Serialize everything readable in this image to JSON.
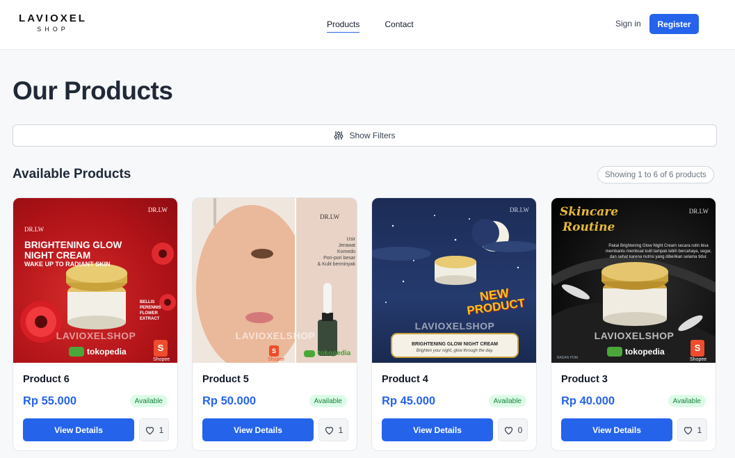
{
  "header": {
    "logo_main": "LAVIOXEL",
    "logo_sub": "SHOP",
    "nav": [
      {
        "label": "Products"
      },
      {
        "label": "Contact"
      }
    ],
    "signin_label": "Sign in",
    "register_label": "Register"
  },
  "page": {
    "title": "Our Products",
    "filter_label": "Show Filters",
    "section_title": "Available Products",
    "showing_text": "Showing 1 to 6 of 6 products"
  },
  "products": [
    {
      "name": "Product 6",
      "price": "Rp 55.000",
      "status": "Available",
      "view_label": "View Details",
      "likes": "1",
      "image": {
        "brand": "DR.LW",
        "headline1": "BRIGHTENING GLOW",
        "headline2": "NIGHT CREAM",
        "tagline": "WAKE UP TO RADIANT SKIN",
        "ingredient": "BELLIS PERENNIS FLOWER EXTRACT",
        "watermark": "LAVIOXELSHOP",
        "marketplace": "tokopedia",
        "shop": "Shopee"
      }
    },
    {
      "name": "Product 5",
      "price": "Rp 50.000",
      "status": "Available",
      "view_label": "View Details",
      "likes": "1",
      "image": {
        "brand": "DR.LW",
        "benefits": [
          "Usir",
          "Jerawat",
          "Komedo",
          "Pori-pori besar",
          "& Kulit berminyak"
        ],
        "watermark": "LAVIOXELSHOP",
        "marketplace": "tokopedia",
        "shop": "Shopee"
      }
    },
    {
      "name": "Product 4",
      "price": "Rp 45.000",
      "status": "Available",
      "view_label": "View Details",
      "likes": "0",
      "image": {
        "brand": "DR.LW",
        "new_line1": "NEW",
        "new_line2": "PRODUCT",
        "watermark": "LAVIOXELSHOP",
        "banner_title": "BRIGHTENING GLOW NIGHT CREAM",
        "banner_sub": "Brighten your night, glow through the day."
      }
    },
    {
      "name": "Product 3",
      "price": "Rp 40.000",
      "status": "Available",
      "view_label": "View Details",
      "likes": "1",
      "image": {
        "brand": "DR.LW",
        "script1": "Skincare",
        "script2": "Routine",
        "copy": "Pakai Brightening Glow Night Cream secara rutin bisa membantu membuat kulit tampak lebih bercahaya, segar, dan sehat karena nutrisi yang diberikan selama tidur.",
        "watermark": "LAVIOXELSHOP",
        "marketplace": "tokopedia",
        "shop": "Shopee",
        "bpom": "BADAN POM"
      }
    }
  ],
  "colors": {
    "accent": "#2563eb",
    "available_bg": "#dcfce7",
    "available_text": "#15803d"
  }
}
